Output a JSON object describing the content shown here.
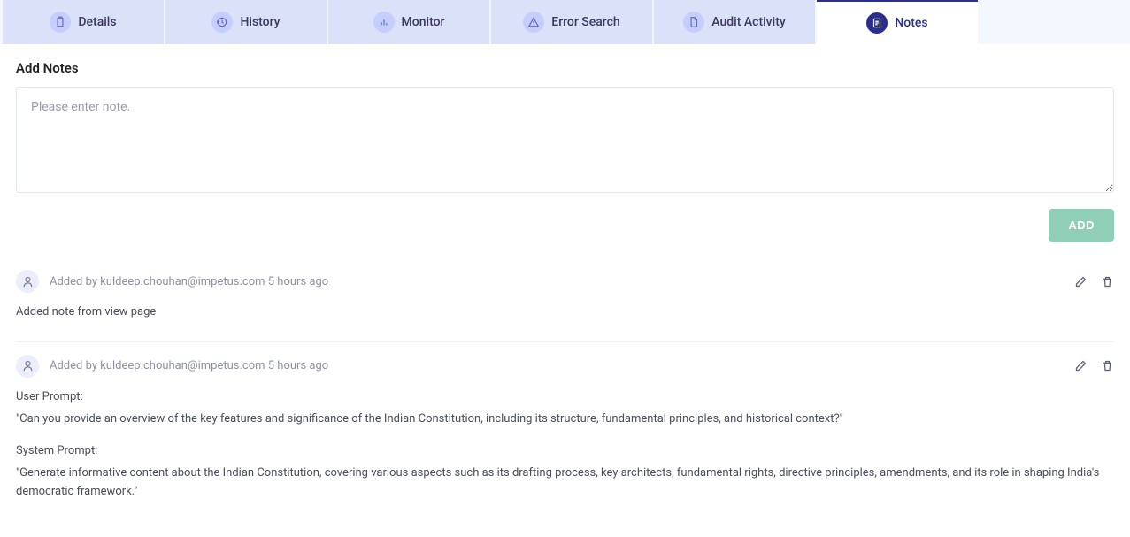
{
  "tabs": [
    {
      "label": "Details",
      "icon": "clipboard"
    },
    {
      "label": "History",
      "icon": "history"
    },
    {
      "label": "Monitor",
      "icon": "bar-chart"
    },
    {
      "label": "Error Search",
      "icon": "alert-triangle"
    },
    {
      "label": "Audit Activity",
      "icon": "document"
    },
    {
      "label": "Notes",
      "icon": "notes",
      "active": true
    }
  ],
  "addNotes": {
    "title": "Add Notes",
    "placeholder": "Please enter note.",
    "addButton": "ADD"
  },
  "notes": [
    {
      "metaPrefix": "Added by",
      "author": "kuldeep.chouhan@impetus.com",
      "time": "5 hours ago",
      "body": {
        "type": "simple",
        "text": "Added note from view page"
      }
    },
    {
      "metaPrefix": "Added by",
      "author": "kuldeep.chouhan@impetus.com",
      "time": "5 hours ago",
      "body": {
        "type": "prompts",
        "userPromptLabel": "User Prompt:",
        "userPromptText": "\"Can you provide an overview of the key features and significance of the Indian Constitution, including its structure, fundamental principles, and historical context?\"",
        "systemPromptLabel": "System Prompt:",
        "systemPromptText": "\"Generate informative content about the Indian Constitution, covering various aspects such as its drafting process, key architects, fundamental rights, directive principles, amendments, and its role in shaping India's democratic framework.\""
      }
    }
  ]
}
